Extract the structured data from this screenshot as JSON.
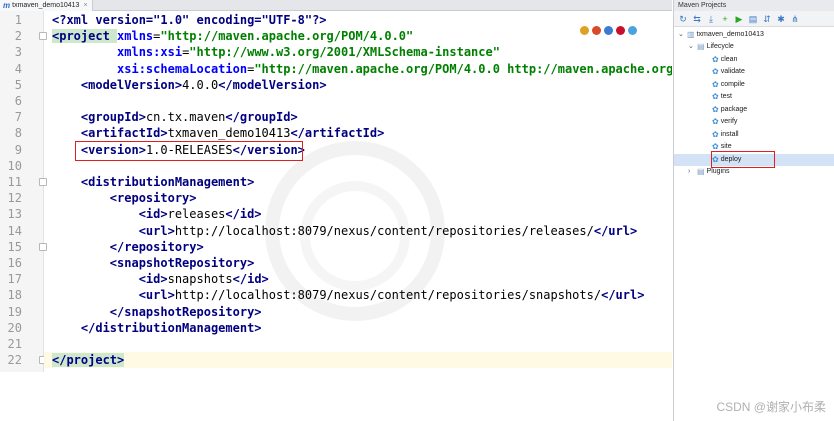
{
  "editor": {
    "tab": {
      "icon": "m",
      "title": "txmaven_demo10413",
      "close": "×"
    },
    "lines": [
      {
        "n": "1",
        "segs": [
          [
            "pi",
            "<?xml version=\"1.0\" encoding=\"UTF-8\"?>"
          ]
        ]
      },
      {
        "n": "2",
        "segs": [
          [
            "tag",
            "<project "
          ],
          [
            "attr",
            "xmlns"
          ],
          [
            "txt",
            "="
          ],
          [
            "val",
            "\"http://maven.apache.org/POM/4.0.0\""
          ]
        ]
      },
      {
        "n": "3",
        "segs": [
          [
            "txt",
            "         "
          ],
          [
            "attr",
            "xmlns:xsi"
          ],
          [
            "txt",
            "="
          ],
          [
            "val",
            "\"http://www.w3.org/2001/XMLSchema-instance\""
          ]
        ]
      },
      {
        "n": "4",
        "segs": [
          [
            "txt",
            "         "
          ],
          [
            "attr",
            "xsi:schemaLocation"
          ],
          [
            "txt",
            "="
          ],
          [
            "val",
            "\"http://maven.apache.org/POM/4.0.0 http://maven.apache.org/"
          ]
        ]
      },
      {
        "n": "5",
        "segs": [
          [
            "txt",
            "    "
          ],
          [
            "tag",
            "<modelVersion>"
          ],
          [
            "txt",
            "4.0.0"
          ],
          [
            "tag",
            "</modelVersion>"
          ]
        ]
      },
      {
        "n": "6",
        "segs": []
      },
      {
        "n": "7",
        "segs": [
          [
            "txt",
            "    "
          ],
          [
            "tag",
            "<groupId>"
          ],
          [
            "txt",
            "cn.tx.maven"
          ],
          [
            "tag",
            "</groupId>"
          ]
        ]
      },
      {
        "n": "8",
        "segs": [
          [
            "txt",
            "    "
          ],
          [
            "tag",
            "<artifactId>"
          ],
          [
            "txt",
            "txmaven_demo10413"
          ],
          [
            "tag",
            "</artifactId>"
          ]
        ]
      },
      {
        "n": "9",
        "segs": [
          [
            "txt",
            "    "
          ],
          [
            "tag",
            "<version>"
          ],
          [
            "txt",
            "1.0-RELEASES"
          ],
          [
            "tag",
            "</version>"
          ]
        ]
      },
      {
        "n": "10",
        "segs": []
      },
      {
        "n": "11",
        "segs": [
          [
            "txt",
            "    "
          ],
          [
            "tag",
            "<distributionManagement>"
          ]
        ]
      },
      {
        "n": "12",
        "segs": [
          [
            "txt",
            "        "
          ],
          [
            "tag",
            "<repository>"
          ]
        ]
      },
      {
        "n": "13",
        "segs": [
          [
            "txt",
            "            "
          ],
          [
            "tag",
            "<id>"
          ],
          [
            "txt",
            "releases"
          ],
          [
            "tag",
            "</id>"
          ]
        ]
      },
      {
        "n": "14",
        "segs": [
          [
            "txt",
            "            "
          ],
          [
            "tag",
            "<url>"
          ],
          [
            "txt",
            "http://localhost:8079/nexus/content/repositories/releases/"
          ],
          [
            "tag",
            "</url>"
          ]
        ]
      },
      {
        "n": "15",
        "segs": [
          [
            "txt",
            "        "
          ],
          [
            "tag",
            "</repository>"
          ]
        ]
      },
      {
        "n": "16",
        "segs": [
          [
            "txt",
            "        "
          ],
          [
            "tag",
            "<snapshotRepository>"
          ]
        ]
      },
      {
        "n": "17",
        "segs": [
          [
            "txt",
            "            "
          ],
          [
            "tag",
            "<id>"
          ],
          [
            "txt",
            "snapshots"
          ],
          [
            "tag",
            "</id>"
          ]
        ]
      },
      {
        "n": "18",
        "segs": [
          [
            "txt",
            "            "
          ],
          [
            "tag",
            "<url>"
          ],
          [
            "txt",
            "http://localhost:8079/nexus/content/repositories/snapshots/"
          ],
          [
            "tag",
            "</url>"
          ]
        ]
      },
      {
        "n": "19",
        "segs": [
          [
            "txt",
            "        "
          ],
          [
            "tag",
            "</snapshotRepository>"
          ]
        ]
      },
      {
        "n": "20",
        "segs": [
          [
            "txt",
            "    "
          ],
          [
            "tag",
            "</distributionManagement>"
          ]
        ]
      },
      {
        "n": "21",
        "segs": []
      },
      {
        "n": "22",
        "segs": [
          [
            "tag",
            "</project>"
          ]
        ]
      }
    ]
  },
  "maven": {
    "title": "Maven Projects",
    "toolbar": [
      "refresh-icon",
      "reimport-icon",
      "download-icon",
      "add-icon",
      "run-icon",
      "run-config-icon",
      "toggle-offline-icon",
      "settings-icon",
      "collapse-icon"
    ],
    "project": "txmaven_demo10413",
    "lifecycle_label": "Lifecycle",
    "lifecycle": [
      "clean",
      "validate",
      "compile",
      "test",
      "package",
      "verify",
      "install",
      "site",
      "deploy"
    ],
    "selected_goal": "deploy",
    "plugins_label": "Plugins"
  },
  "credit": "CSDN @谢家小布柔",
  "colors": {
    "tag": "#000080",
    "attr": "#0000ff",
    "value": "#008000",
    "highlight_box": "#e02020"
  }
}
